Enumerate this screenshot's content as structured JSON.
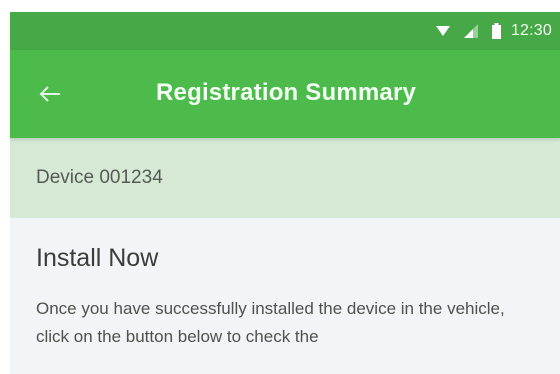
{
  "status_bar": {
    "time": "12:30",
    "icons": [
      "wifi-icon",
      "cell-signal-icon",
      "battery-icon"
    ]
  },
  "app_bar": {
    "back_icon": "arrow-left-icon",
    "title": "Registration Summary"
  },
  "device": {
    "label": "Device 001234"
  },
  "install": {
    "title": "Install Now",
    "body": "Once you have successfully installed the device in the vehicle, click on the button below to check the"
  },
  "colors": {
    "status_bar": "#47a847",
    "app_bar": "#4cbb4c",
    "device_band": "#d5e9d5",
    "content_bg": "#f2f5f7",
    "title_text": "#f4fff4"
  }
}
